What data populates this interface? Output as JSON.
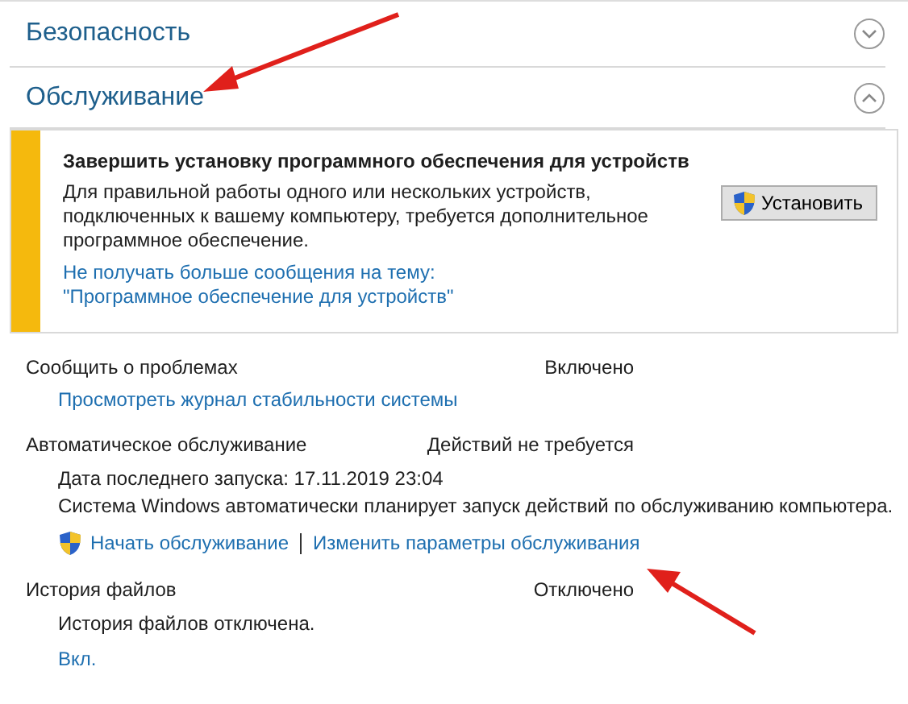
{
  "sections": [
    {
      "title": "Безопасность",
      "expanded": false
    },
    {
      "title": "Обслуживание",
      "expanded": true
    }
  ],
  "alert": {
    "title": "Завершить установку программного обеспечения для устройств",
    "text": "Для правильной работы одного или нескольких устройств, подключенных к вашему компьютеру, требуется дополнительное программное обеспечение.",
    "button": "Установить",
    "links": [
      "Не получать больше сообщения на тему:",
      "\"Программное обеспечение для устройств\""
    ]
  },
  "items": [
    {
      "label": "Сообщить о проблемах",
      "status": "Включено",
      "links": [
        {
          "text": "Просмотреть журнал стабильности системы",
          "shield": false
        }
      ]
    },
    {
      "label": "Автоматическое обслуживание",
      "status": "Действий не требуется",
      "lines": [
        "Дата последнего запуска: 17.11.2019 23:04",
        "Система Windows автоматически планирует запуск действий по обслуживанию компьютера."
      ],
      "links": [
        {
          "text": "Начать обслуживание",
          "shield": true
        },
        {
          "text": "Изменить параметры обслуживания",
          "shield": false
        }
      ]
    },
    {
      "label": "История файлов",
      "status": "Отключено",
      "lines": [
        "История файлов отключена."
      ],
      "links": [
        {
          "text": "Вкл.",
          "shield": false
        }
      ]
    }
  ]
}
